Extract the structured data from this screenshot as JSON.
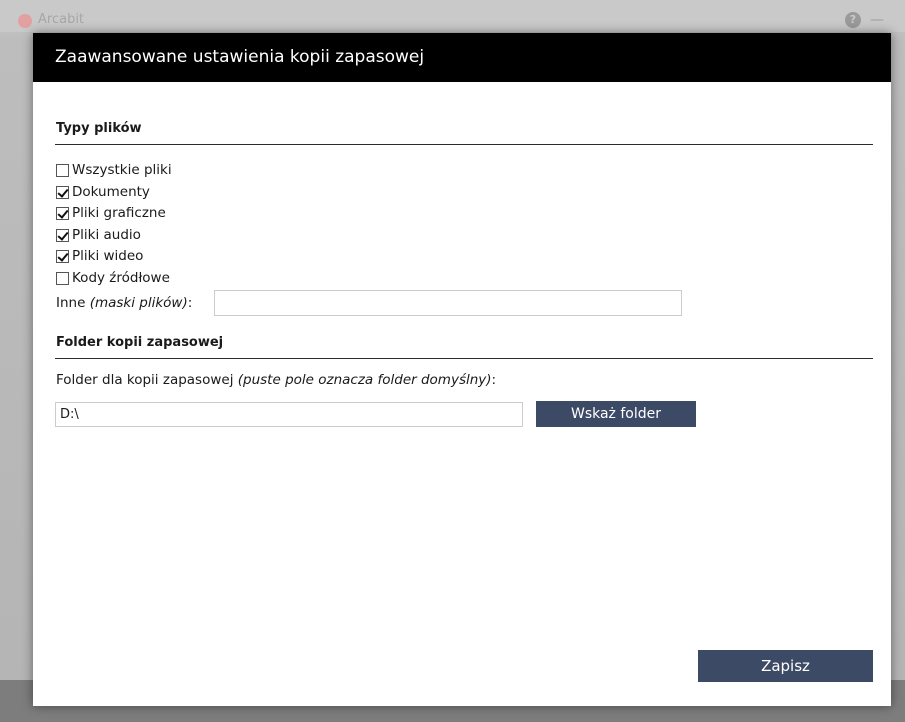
{
  "background": {
    "app_title": "Arcabit",
    "help_icon_glyph": "?"
  },
  "dialog": {
    "title": "Zaawansowane ustawienia kopii zapasowej",
    "file_types": {
      "heading": "Typy plików",
      "options": [
        {
          "label": "Wszystkie pliki",
          "checked": false
        },
        {
          "label": "Dokumenty",
          "checked": true
        },
        {
          "label": "Pliki graficzne",
          "checked": true
        },
        {
          "label": "Pliki audio",
          "checked": true
        },
        {
          "label": "Pliki wideo",
          "checked": true
        },
        {
          "label": "Kody źródłowe",
          "checked": false
        }
      ],
      "other_label": "Inne ",
      "other_label_italic": "(maski plików)",
      "other_label_suffix": ":",
      "other_value": ""
    },
    "backup_folder": {
      "heading": "Folder kopii zapasowej",
      "description": "Folder dla kopii zapasowej ",
      "description_italic": "(puste pole oznacza folder domyślny)",
      "description_suffix": ":",
      "folder_value": "D:\\",
      "browse_button": "Wskaż folder"
    },
    "save_button": "Zapisz"
  },
  "colors": {
    "header_bg": "#000000",
    "button_bg": "#3d4a66",
    "button_text": "#ffffff"
  }
}
